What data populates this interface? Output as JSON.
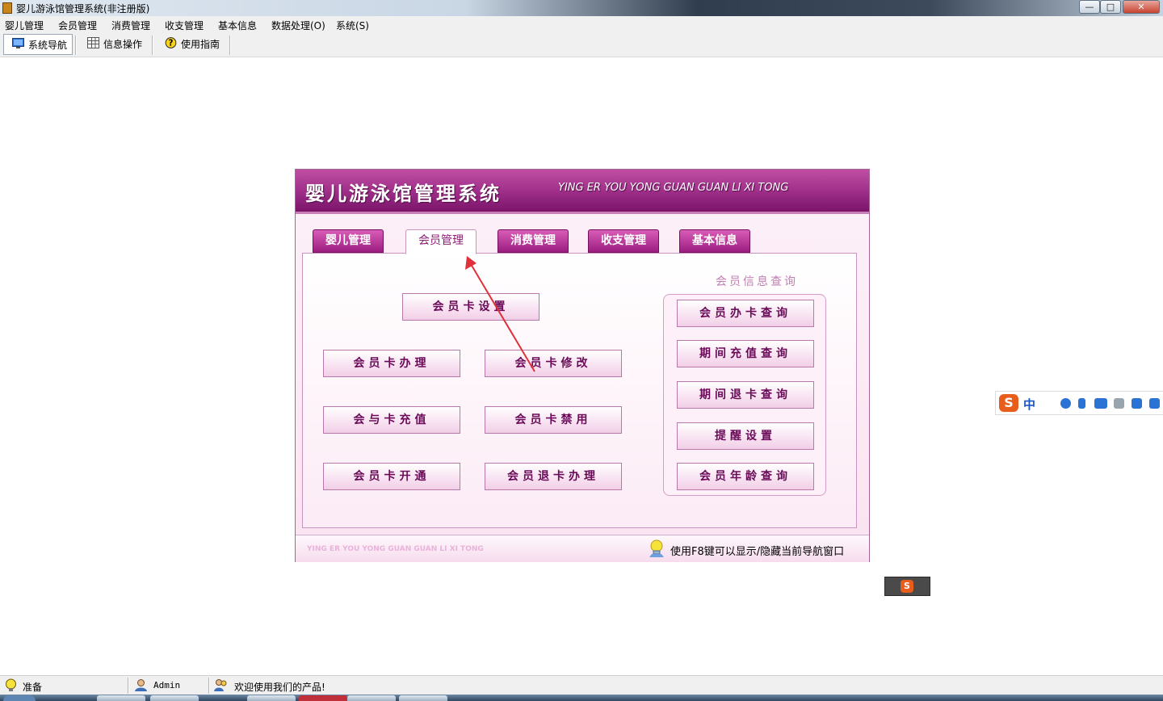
{
  "window": {
    "title": "婴儿游泳馆管理系统(非注册版)",
    "min_glyph": "—",
    "max_glyph": "□",
    "close_glyph": "✕"
  },
  "menubar": {
    "items": [
      {
        "label": "婴儿管理"
      },
      {
        "label": "会员管理"
      },
      {
        "label": "消费管理"
      },
      {
        "label": "收支管理"
      },
      {
        "label": "基本信息"
      },
      {
        "label": "数据处理(O)"
      },
      {
        "label": "系统(S)"
      }
    ]
  },
  "toolbar": {
    "items": [
      {
        "label": "系统导航",
        "icon": "monitor-icon"
      },
      {
        "label": "信息操作",
        "icon": "table-icon"
      },
      {
        "label": "使用指南",
        "icon": "help-icon"
      }
    ]
  },
  "nav_panel": {
    "title": "婴儿游泳馆管理系统",
    "subtitle": "YING ER YOU YONG GUAN GUAN LI XI TONG",
    "tabs": [
      {
        "label": "婴儿管理",
        "active": false
      },
      {
        "label": "会员管理",
        "active": true
      },
      {
        "label": "消费管理",
        "active": false
      },
      {
        "label": "收支管理",
        "active": false
      },
      {
        "label": "基本信息",
        "active": false
      }
    ],
    "buttons": {
      "card_settings": "会员卡设置",
      "card_apply": "会员卡办理",
      "card_modify": "会员卡修改",
      "card_recharge": "会与卡充值",
      "card_disable": "会员卡禁用",
      "card_activate": "会员卡开通",
      "card_refund": "会员退卡办理"
    },
    "query": {
      "title": "会员信息查询",
      "buttons": [
        "会员办卡查询",
        "期间充值查询",
        "期间退卡查询",
        "提醒设置",
        "会员年龄查询"
      ]
    },
    "footer": {
      "english": "YING ER YOU YONG GUAN GUAN LI XI TONG",
      "tip": "使用F8键可以显示/隐藏当前导航窗口"
    },
    "colors": {
      "banner": "#a0308a",
      "button_text": "#6a0a58",
      "arrow": "#e0303a"
    }
  },
  "ime": {
    "logo": "S",
    "lang": "中"
  },
  "statusbar": {
    "status": "准备",
    "user": "Admin",
    "message": "欢迎使用我们的产品!"
  }
}
